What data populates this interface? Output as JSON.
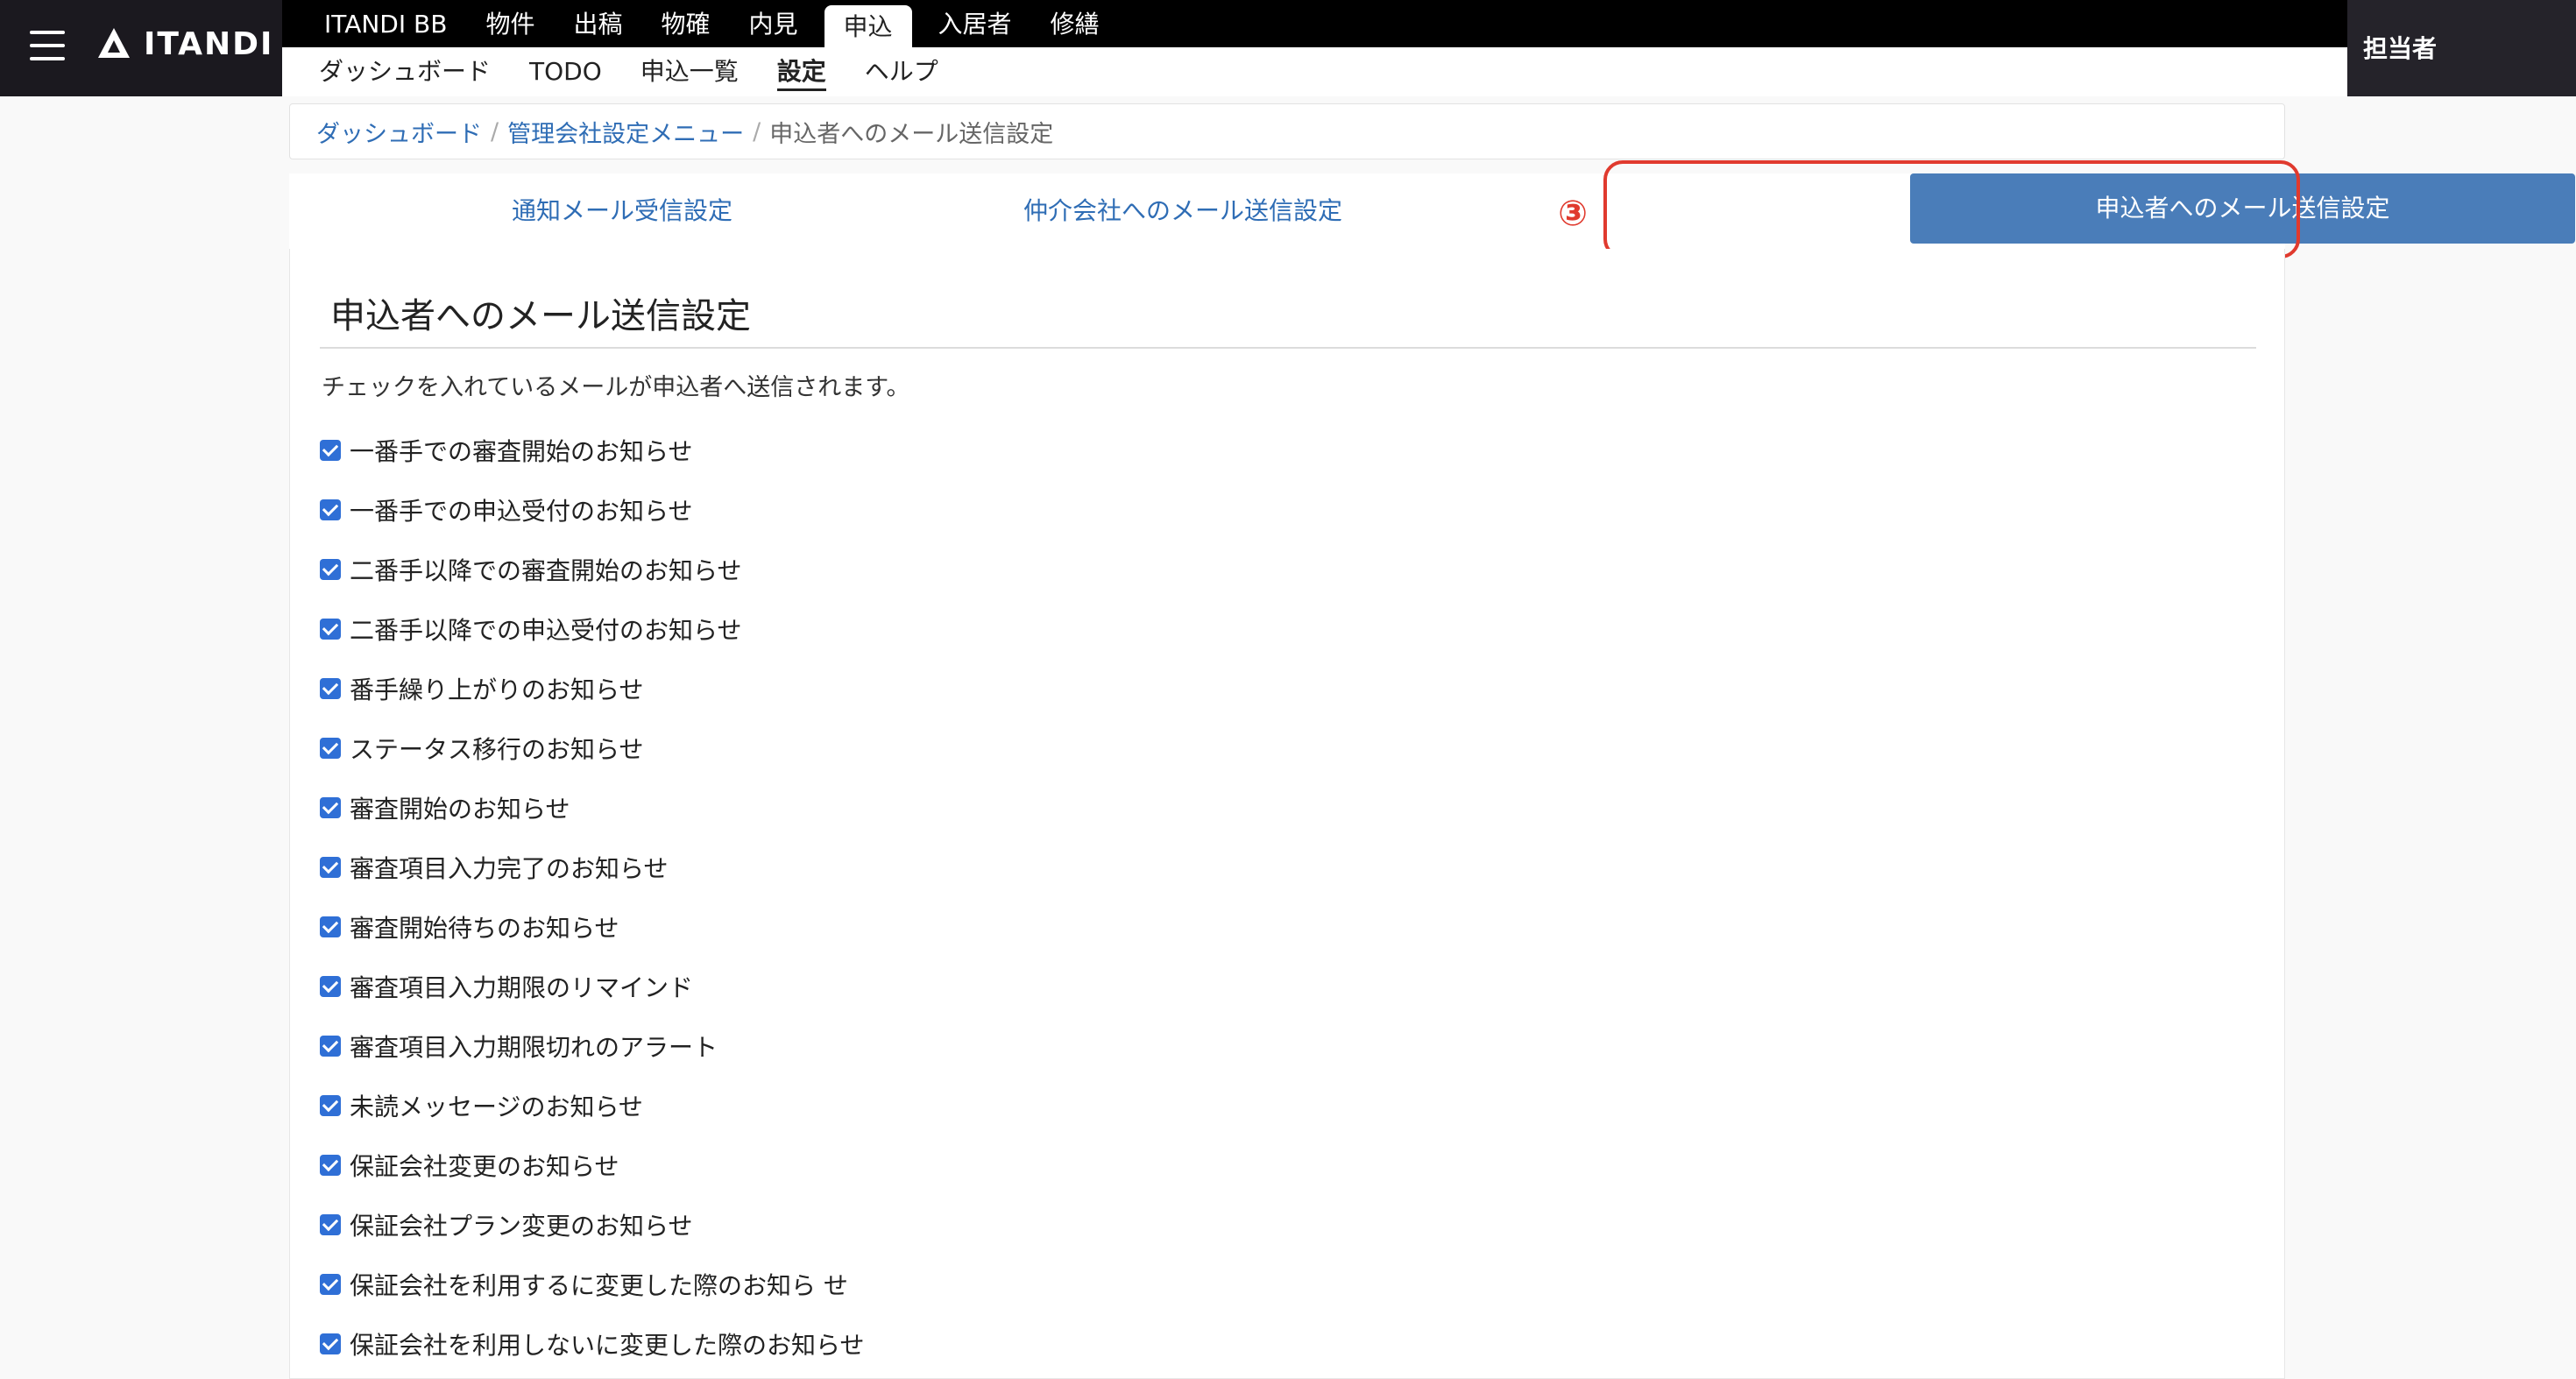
{
  "app": {
    "logo_text": "ITANDI",
    "user_name": "担当者"
  },
  "top_nav": [
    "ITANDI BB",
    "物件",
    "出稿",
    "物確",
    "内見",
    "申込",
    "入居者",
    "修繕"
  ],
  "top_nav_active": "申込",
  "sub_nav": [
    "ダッシュボード",
    "TODO",
    "申込一覧",
    "設定",
    "ヘルプ"
  ],
  "sub_nav_active": "設定",
  "breadcrumb": {
    "items": [
      "ダッシュボード",
      "管理会社設定メニュー"
    ],
    "current": "申込者へのメール送信設定",
    "separator": "/"
  },
  "tabs": {
    "tab1": "通知メール受信設定",
    "tab2": "仲介会社へのメール送信設定",
    "tab3": "申込者へのメール送信設定"
  },
  "annotation": {
    "step": "③",
    "color": "#e03a2e"
  },
  "panel": {
    "title": "申込者へのメール送信設定",
    "description": "チェックを入れているメールが申込者へ送信されます。",
    "options": [
      {
        "label": "一番手での審査開始のお知らせ",
        "checked": true
      },
      {
        "label": "一番手での申込受付のお知らせ",
        "checked": true
      },
      {
        "label": "二番手以降での審査開始のお知らせ",
        "checked": true
      },
      {
        "label": "二番手以降での申込受付のお知らせ",
        "checked": true
      },
      {
        "label": "番手繰り上がりのお知らせ",
        "checked": true
      },
      {
        "label": "ステータス移行のお知らせ",
        "checked": true
      },
      {
        "label": "審査開始のお知らせ",
        "checked": true
      },
      {
        "label": "審査項目入力完了のお知らせ",
        "checked": true
      },
      {
        "label": "審査開始待ちのお知らせ",
        "checked": true
      },
      {
        "label": "審査項目入力期限のリマインド",
        "checked": true
      },
      {
        "label": "審査項目入力期限切れのアラート",
        "checked": true
      },
      {
        "label": "未読メッセージのお知らせ",
        "checked": true
      },
      {
        "label": "保証会社変更のお知らせ",
        "checked": true
      },
      {
        "label": "保証会社プラン変更のお知らせ",
        "checked": true
      },
      {
        "label": "保証会社を利用するに変更した際のお知ら せ",
        "checked": true
      },
      {
        "label": "保証会社を利用しないに変更した際のお知らせ",
        "checked": true
      }
    ]
  },
  "colors": {
    "header_bg": "#1b191f",
    "accent": "#4a7db9",
    "link": "#2f6db5"
  }
}
